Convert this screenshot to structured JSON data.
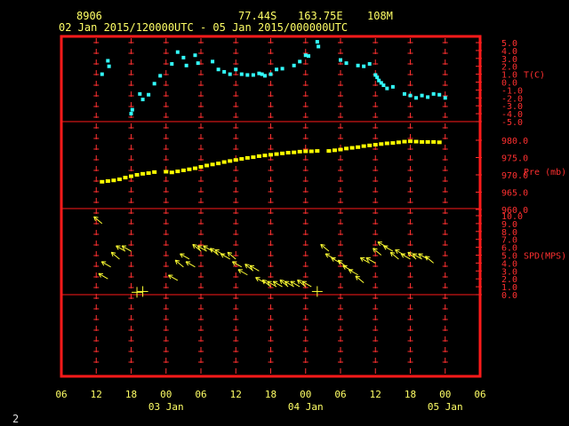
{
  "header": {
    "station": "8906",
    "lat": "77.44S",
    "lon": "163.75E",
    "elev": "108M",
    "period": "02 Jan 2015/120000UTC - 05 Jan 2015/000000UTC"
  },
  "footer": {
    "page": "2"
  },
  "colors": {
    "frame": "#ff1a1a",
    "axis": "#ff3030",
    "text": "#ffff66",
    "temp": "#33ffff",
    "pres": "#ffff00",
    "wind": "#ffff33"
  },
  "chart_data": {
    "type": "scatter",
    "x_unit": "hours since 02 Jan 2015 06 UTC",
    "x_range": [
      0,
      72
    ],
    "x_ticks": [
      "06",
      "12",
      "18",
      "00",
      "06",
      "12",
      "18",
      "00",
      "06",
      "12",
      "18",
      "00",
      "06"
    ],
    "date_labels": [
      {
        "label": "03 Jan",
        "x": 18
      },
      {
        "label": "04 Jan",
        "x": 42
      },
      {
        "label": "05 Jan",
        "x": 66
      }
    ],
    "panels": [
      {
        "name": "T(C)",
        "ylim": [
          -5,
          5.5
        ],
        "ticks": [
          "5.0",
          "4.0",
          "3.0",
          "2.0",
          "1.0",
          "0.0",
          "-1.0",
          "-2.0",
          "-3.0",
          "-4.0",
          "-5.0"
        ],
        "tick_values": [
          5,
          4,
          3,
          2,
          1,
          0,
          -1,
          -2,
          -3,
          -4,
          -5
        ],
        "points": [
          [
            7,
            1
          ],
          [
            8,
            2.7
          ],
          [
            8.2,
            2.0
          ],
          [
            12,
            -4
          ],
          [
            12.2,
            -3.5
          ],
          [
            13.5,
            -1.5
          ],
          [
            14,
            -2.2
          ],
          [
            15,
            -1.6
          ],
          [
            16,
            -0.2
          ],
          [
            17,
            0.8
          ],
          [
            19,
            2.3
          ],
          [
            20,
            3.8
          ],
          [
            21,
            3.1
          ],
          [
            21.5,
            2.1
          ],
          [
            23,
            3.4
          ],
          [
            23.5,
            2.4
          ],
          [
            26,
            2.6
          ],
          [
            27,
            1.6
          ],
          [
            28,
            1.3
          ],
          [
            29,
            1.0
          ],
          [
            30,
            1.6
          ],
          [
            31,
            1.0
          ],
          [
            32,
            0.9
          ],
          [
            33,
            0.9
          ],
          [
            34,
            1.1
          ],
          [
            34.5,
            1.0
          ],
          [
            35,
            0.8
          ],
          [
            36,
            1.0
          ],
          [
            37,
            1.6
          ],
          [
            38,
            1.7
          ],
          [
            40,
            2.1
          ],
          [
            41,
            2.6
          ],
          [
            42,
            3.4
          ],
          [
            42.5,
            3.3
          ],
          [
            44,
            5.1
          ],
          [
            44.2,
            4.5
          ],
          [
            48,
            2.8
          ],
          [
            49,
            2.4
          ],
          [
            51,
            2.1
          ],
          [
            52,
            2.0
          ],
          [
            53,
            2.3
          ],
          [
            54,
            0.9
          ],
          [
            54.3,
            0.6
          ],
          [
            54.6,
            0.2
          ],
          [
            55,
            -0.1
          ],
          [
            55.4,
            -0.4
          ],
          [
            56,
            -0.8
          ],
          [
            57,
            -0.6
          ],
          [
            59,
            -1.5
          ],
          [
            60,
            -1.7
          ],
          [
            61,
            -2.0
          ],
          [
            62,
            -1.7
          ],
          [
            63,
            -1.9
          ],
          [
            64,
            -1.5
          ],
          [
            65,
            -1.6
          ],
          [
            66,
            -2.0
          ]
        ],
        "color": "#33ffff"
      },
      {
        "name": "Pre (mb)",
        "ylim": [
          960,
          984
        ],
        "ticks": [
          "980.0",
          "975.0",
          "970.0",
          "965.0",
          "960.0"
        ],
        "tick_values": [
          980,
          975,
          970,
          965,
          960
        ],
        "points": [
          [
            7,
            968
          ],
          [
            8,
            968.2
          ],
          [
            9,
            968.4
          ],
          [
            10,
            968.7
          ],
          [
            11,
            969.2
          ],
          [
            12,
            969.6
          ],
          [
            13,
            970
          ],
          [
            14,
            970.3
          ],
          [
            15,
            970.5
          ],
          [
            16,
            970.8
          ],
          [
            18,
            970.9
          ],
          [
            19,
            970.7
          ],
          [
            20,
            971.0
          ],
          [
            21,
            971.3
          ],
          [
            22,
            971.6
          ],
          [
            23,
            971.9
          ],
          [
            24,
            972.3
          ],
          [
            25,
            972.7
          ],
          [
            26,
            973.0
          ],
          [
            27,
            973.3
          ],
          [
            28,
            973.7
          ],
          [
            29,
            974.0
          ],
          [
            30,
            974.3
          ],
          [
            31,
            974.6
          ],
          [
            32,
            974.9
          ],
          [
            33,
            975.1
          ],
          [
            34,
            975.4
          ],
          [
            35,
            975.6
          ],
          [
            36,
            975.8
          ],
          [
            37,
            976.0
          ],
          [
            38,
            976.2
          ],
          [
            39,
            976.4
          ],
          [
            40,
            976.5
          ],
          [
            41,
            976.7
          ],
          [
            42,
            976.8
          ],
          [
            43,
            976.8
          ],
          [
            44,
            976.9
          ],
          [
            46,
            976.9
          ],
          [
            47,
            977.1
          ],
          [
            48,
            977.3
          ],
          [
            49,
            977.6
          ],
          [
            50,
            977.8
          ],
          [
            51,
            978.0
          ],
          [
            52,
            978.3
          ],
          [
            53,
            978.5
          ],
          [
            54,
            978.7
          ],
          [
            55,
            978.9
          ],
          [
            56,
            979.1
          ],
          [
            57,
            979.2
          ],
          [
            58,
            979.4
          ],
          [
            59,
            979.6
          ],
          [
            60,
            979.7
          ],
          [
            61,
            979.6
          ],
          [
            62,
            979.5
          ],
          [
            63,
            979.5
          ],
          [
            64,
            979.5
          ],
          [
            65,
            979.4
          ]
        ],
        "color": "#ffff00"
      },
      {
        "name": "SPD(MPS)",
        "ylim": [
          0,
          10.5
        ],
        "ticks": [
          "10.0",
          "9.0",
          "8.0",
          "7.0",
          "6.0",
          "5.0",
          "4.0",
          "3.0",
          "2.0",
          "1.0",
          "0.0"
        ],
        "tick_values": [
          10,
          9,
          8,
          7,
          6,
          5,
          4,
          3,
          2,
          1,
          0
        ],
        "points": [
          [
            7,
            9
          ],
          [
            8,
            2
          ],
          [
            8.5,
            3.5
          ],
          [
            10,
            4.5
          ],
          [
            11,
            5.5
          ],
          [
            12,
            5.5
          ],
          [
            13,
            0.3
          ],
          [
            14,
            0.4
          ],
          [
            20,
            1.8
          ],
          [
            21,
            3.5
          ],
          [
            22,
            4.5
          ],
          [
            23,
            3.5
          ],
          [
            24,
            5.5
          ],
          [
            25,
            5.5
          ],
          [
            26,
            5.5
          ],
          [
            27,
            5
          ],
          [
            28,
            5
          ],
          [
            29,
            4.5
          ],
          [
            30,
            4.5
          ],
          [
            31,
            3.5
          ],
          [
            32,
            2.5
          ],
          [
            33,
            3
          ],
          [
            34,
            3
          ],
          [
            35,
            1.5
          ],
          [
            36,
            1
          ],
          [
            37,
            1
          ],
          [
            38,
            1
          ],
          [
            39,
            1
          ],
          [
            40,
            1
          ],
          [
            41,
            1
          ],
          [
            42,
            1
          ],
          [
            43,
            1
          ],
          [
            44,
            0.4
          ],
          [
            46,
            5.5
          ],
          [
            47,
            4.5
          ],
          [
            48,
            4
          ],
          [
            49,
            3.5
          ],
          [
            50,
            3
          ],
          [
            51,
            2.5
          ],
          [
            52,
            1.5
          ],
          [
            53,
            4
          ],
          [
            54,
            4
          ],
          [
            55,
            5
          ],
          [
            56,
            6
          ],
          [
            57,
            5.5
          ],
          [
            58,
            4.5
          ],
          [
            59,
            5
          ],
          [
            60,
            4.5
          ],
          [
            61,
            4.5
          ],
          [
            62,
            4.5
          ],
          [
            63,
            4.5
          ],
          [
            64,
            4
          ]
        ],
        "color": "#ffff33"
      }
    ]
  }
}
